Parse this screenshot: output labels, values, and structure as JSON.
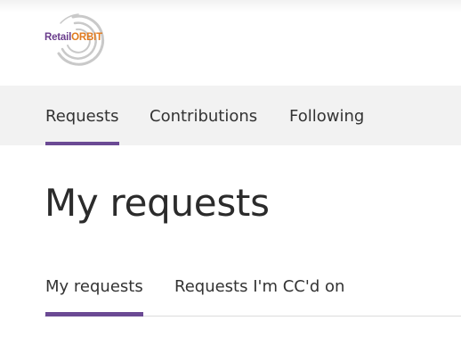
{
  "header": {
    "logo": {
      "text_part1": "Retail",
      "text_part2": "ORBIT",
      "colors": {
        "retail": "#6a3d8c",
        "orbit": "#e07a1f",
        "rings": "#c7c7c7"
      }
    }
  },
  "nav": {
    "items": [
      {
        "label": "Requests",
        "active": true
      },
      {
        "label": "Contributions",
        "active": false
      },
      {
        "label": "Following",
        "active": false
      }
    ],
    "accent_color": "#6b4a94"
  },
  "main": {
    "title": "My requests",
    "tabs": [
      {
        "label": "My requests",
        "active": true
      },
      {
        "label": "Requests I'm CC'd on",
        "active": false
      }
    ]
  }
}
